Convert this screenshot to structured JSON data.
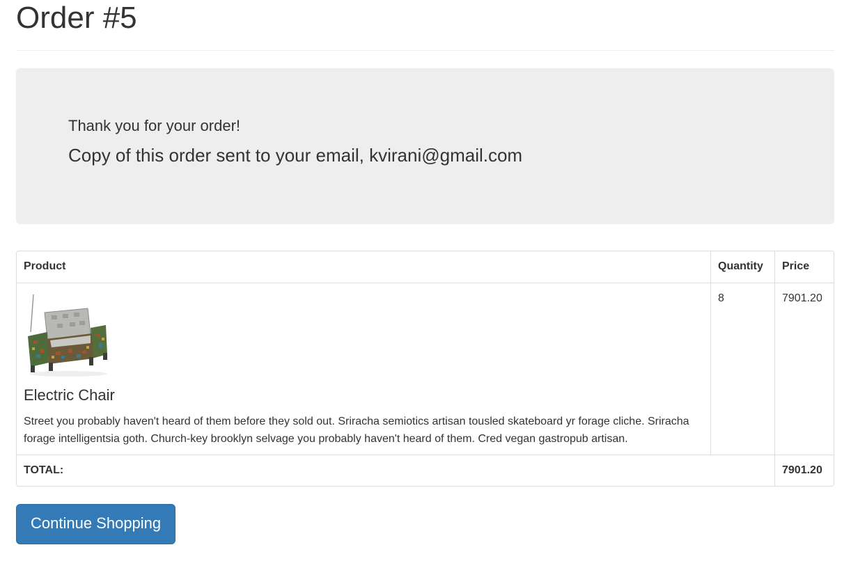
{
  "header": {
    "title": "Order #5"
  },
  "confirmation": {
    "thanks": "Thank you for your order!",
    "email_notice": "Copy of this order sent to your email, kvirani@gmail.com"
  },
  "table": {
    "columns": {
      "product": "Product",
      "quantity": "Quantity",
      "price": "Price"
    },
    "items": [
      {
        "image_icon": "armchair-photo",
        "name": "Electric Chair",
        "description": "Street you probably haven't heard of them before they sold out. Sriracha semiotics artisan tousled skateboard yr forage cliche. Sriracha forage intelligentsia goth. Church-key brooklyn selvage you probably haven't heard of them. Cred vegan gastropub artisan.",
        "quantity": "8",
        "price": "7901.20"
      }
    ],
    "total_label": "TOTAL:",
    "total_value": "7901.20"
  },
  "actions": {
    "continue_label": "Continue Shopping"
  },
  "colors": {
    "button_primary": "#337ab7",
    "jumbotron_bg": "#eeeeee",
    "border": "#dddddd"
  }
}
